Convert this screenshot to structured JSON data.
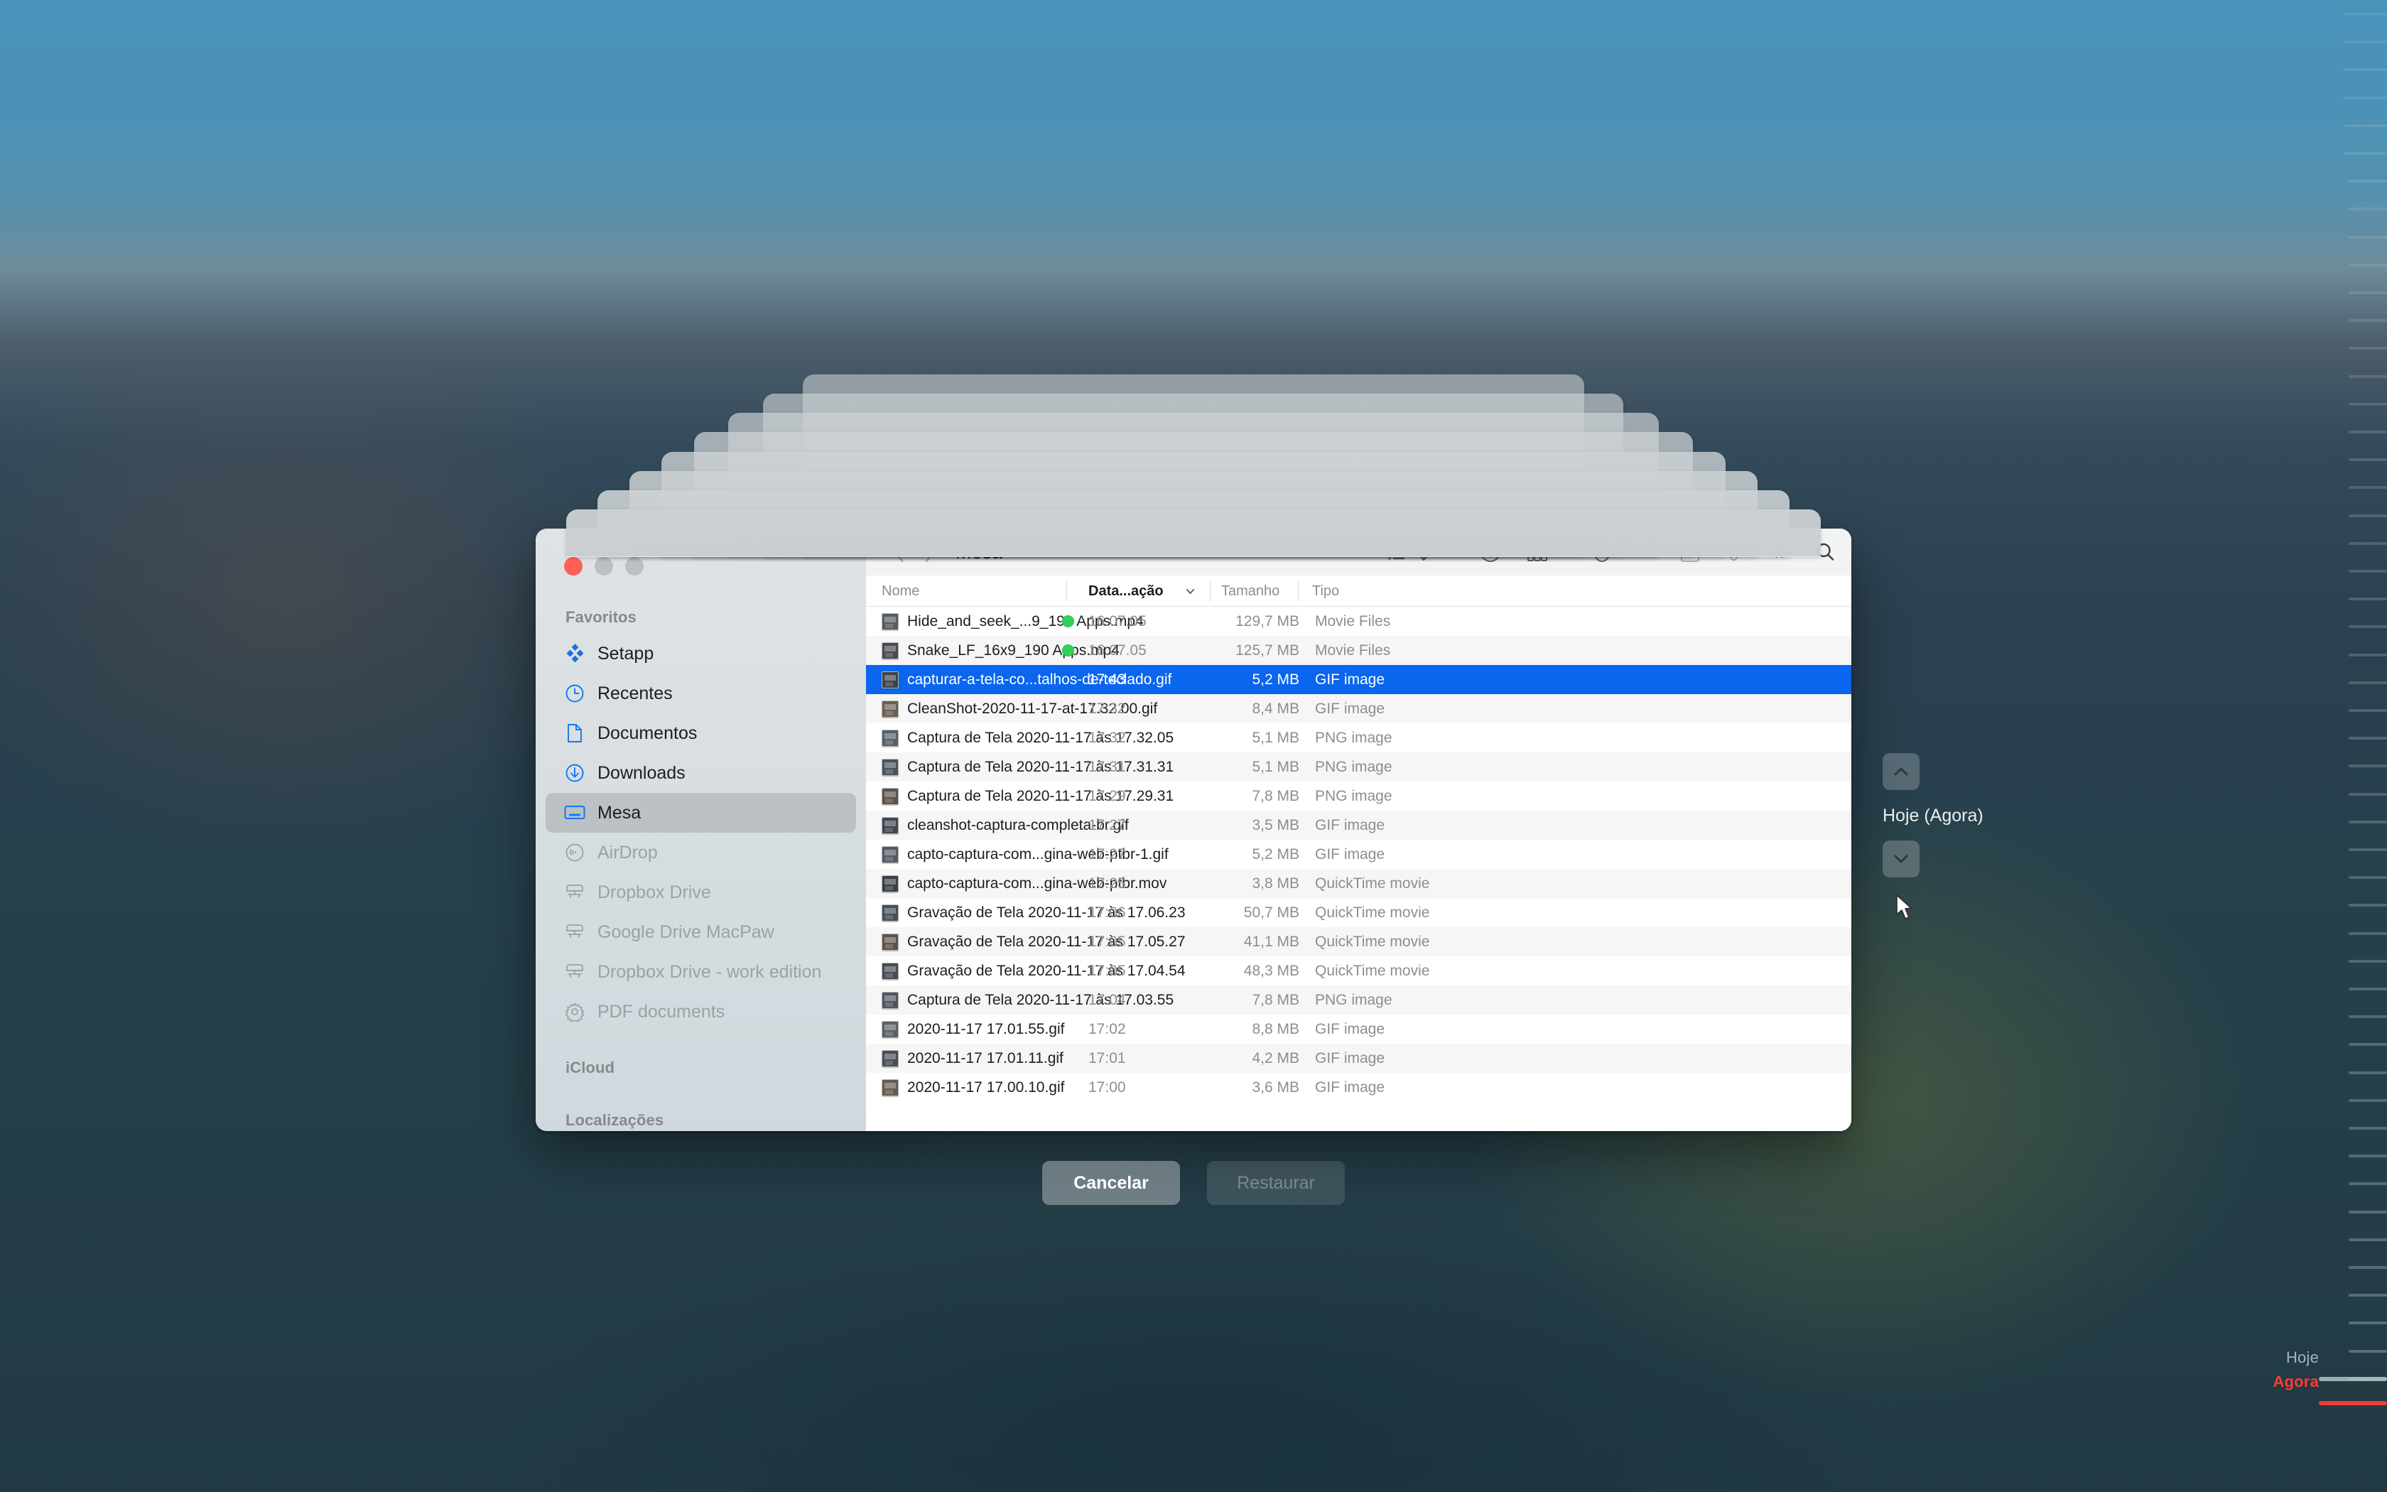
{
  "window": {
    "title": "Mesa",
    "traffic_lights": [
      "close",
      "minimize",
      "maximize"
    ]
  },
  "toolbar": {
    "back_icon": "chevron-left-icon",
    "forward_icon": "chevron-right-icon",
    "view_list_icon": "list-view-icon",
    "sort_icon": "sort-updown-icon",
    "info_icon": "info-circle-icon",
    "group_icon": "group-view-icon",
    "action_icon": "more-circle-icon",
    "share_icon": "share-icon",
    "tag_icon": "tag-icon",
    "more_icon": "double-chevron-right-icon",
    "search_icon": "search-icon"
  },
  "sidebar": {
    "sections": [
      {
        "header": "Favoritos",
        "items": [
          {
            "label": "Setapp",
            "icon": "setapp-icon",
            "state": "normal"
          },
          {
            "label": "Recentes",
            "icon": "clock-icon",
            "state": "normal"
          },
          {
            "label": "Documentos",
            "icon": "doc-icon",
            "state": "normal"
          },
          {
            "label": "Downloads",
            "icon": "download-icon",
            "state": "normal"
          },
          {
            "label": "Mesa",
            "icon": "desktop-icon",
            "state": "selected"
          },
          {
            "label": "AirDrop",
            "icon": "airdrop-icon",
            "state": "dim"
          },
          {
            "label": "Dropbox Drive",
            "icon": "server-icon",
            "state": "dim"
          },
          {
            "label": "Google Drive MacPaw",
            "icon": "server-icon",
            "state": "dim"
          },
          {
            "label": "Dropbox Drive - work edition",
            "icon": "server-icon",
            "state": "dim"
          },
          {
            "label": "PDF documents",
            "icon": "gear-icon",
            "state": "dim"
          }
        ]
      },
      {
        "header": "iCloud",
        "items": []
      },
      {
        "header": "Localizações",
        "items": []
      }
    ]
  },
  "columns": {
    "name": "Nome",
    "date": "Data...ação",
    "size": "Tamanho",
    "type": "Tipo",
    "sort_indicator": "chevron-down-icon"
  },
  "files": [
    {
      "name": "Hide_and_seek_...9_190 Apps.mp4",
      "date": "16.07.05",
      "size": "129,7 MB",
      "type": "Movie Files",
      "tag": true,
      "selected": false
    },
    {
      "name": "Snake_LF_16x9_190 Apps.mp4",
      "date": "16.07.05",
      "size": "125,7 MB",
      "type": "Movie Files",
      "tag": true,
      "selected": false
    },
    {
      "name": "capturar-a-tela-co...talhos-de-teclado.gif",
      "date": "17:43",
      "size": "5,2 MB",
      "type": "GIF image",
      "tag": false,
      "selected": true
    },
    {
      "name": "CleanShot-2020-11-17-at-17.32.00.gif",
      "date": "17:32",
      "size": "8,4 MB",
      "type": "GIF image",
      "tag": false,
      "selected": false
    },
    {
      "name": "Captura de Tela 2020-11-17 às 17.32.05",
      "date": "17:32",
      "size": "5,1 MB",
      "type": "PNG image",
      "tag": false,
      "selected": false
    },
    {
      "name": "Captura de Tela 2020-11-17 às 17.31.31",
      "date": "17:31",
      "size": "5,1 MB",
      "type": "PNG image",
      "tag": false,
      "selected": false
    },
    {
      "name": "Captura de Tela 2020-11-17 às 17.29.31",
      "date": "17:29",
      "size": "7,8 MB",
      "type": "PNG image",
      "tag": false,
      "selected": false
    },
    {
      "name": "cleanshot-captura-completa-br.gif",
      "date": "17:27",
      "size": "3,5 MB",
      "type": "GIF image",
      "tag": false,
      "selected": false
    },
    {
      "name": "capto-captura-com...gina-web-ptbr-1.gif",
      "date": "17:27",
      "size": "5,2 MB",
      "type": "GIF image",
      "tag": false,
      "selected": false
    },
    {
      "name": "capto-captura-com...gina-web-ptbr.mov",
      "date": "17:25",
      "size": "3,8 MB",
      "type": "QuickTime movie",
      "tag": false,
      "selected": false
    },
    {
      "name": "Gravação de Tela 2020-11-17 às 17.06.23",
      "date": "17:06",
      "size": "50,7 MB",
      "type": "QuickTime movie",
      "tag": false,
      "selected": false
    },
    {
      "name": "Gravação de Tela 2020-11-17 às 17.05.27",
      "date": "17:05",
      "size": "41,1 MB",
      "type": "QuickTime movie",
      "tag": false,
      "selected": false
    },
    {
      "name": "Gravação de Tela 2020-11-17 às 17.04.54",
      "date": "17:05",
      "size": "48,3 MB",
      "type": "QuickTime movie",
      "tag": false,
      "selected": false
    },
    {
      "name": "Captura de Tela 2020-11-17 às 17.03.55",
      "date": "17:04",
      "size": "7,8 MB",
      "type": "PNG image",
      "tag": false,
      "selected": false
    },
    {
      "name": "2020-11-17 17.01.55.gif",
      "date": "17:02",
      "size": "8,8 MB",
      "type": "GIF image",
      "tag": false,
      "selected": false
    },
    {
      "name": "2020-11-17 17.01.11.gif",
      "date": "17:01",
      "size": "4,2 MB",
      "type": "GIF image",
      "tag": false,
      "selected": false
    },
    {
      "name": "2020-11-17 17.00.10.gif",
      "date": "17:00",
      "size": "3,6 MB",
      "type": "GIF image",
      "tag": false,
      "selected": false
    }
  ],
  "actions": {
    "cancel_label": "Cancelar",
    "restore_label": "Restaurar"
  },
  "timemachine": {
    "current_snapshot": "Hoje (Agora)",
    "up_icon": "chevron-up-icon",
    "down_icon": "chevron-down-icon",
    "timeline_today_label": "Hoje",
    "timeline_now_label": "Agora",
    "now_color": "#ff3b30",
    "selection_color": "#0a65ef",
    "stacked_window_count": 8
  }
}
